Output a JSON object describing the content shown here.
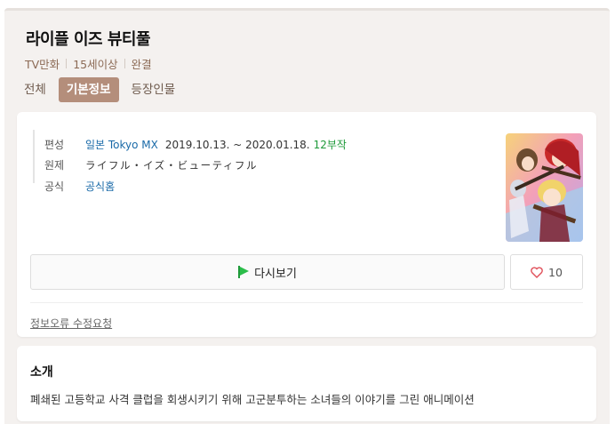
{
  "title": "라이플 이즈 뷰티풀",
  "meta": [
    "TV만화",
    "15세이상",
    "완결"
  ],
  "tabs": [
    {
      "label": "전체",
      "active": false
    },
    {
      "label": "기본정보",
      "active": true
    },
    {
      "label": "등장인물",
      "active": false
    }
  ],
  "info": {
    "broadcast_label": "편성",
    "channel": "일본 Tokyo MX",
    "dates": "2019.10.13. ~ 2020.01.18.",
    "episodes": "12부작",
    "original_label": "원제",
    "original_title": "ライフル・イズ・ビューティフル",
    "official_label": "공식",
    "official_link": "공식홈"
  },
  "poster": {
    "icon": "anime-poster-image"
  },
  "replay_button": "다시보기",
  "like": {
    "count": "10"
  },
  "report_link": "정보오류 수정요청",
  "intro": {
    "title": "소개",
    "text": "폐쇄된 고등학교 사격 클럽을 회생시키기 위해 고군분투하는 소녀들의 이야기를 그린 애니메이션"
  },
  "colors": {
    "accent": "#b48e7b",
    "link_blue": "#1a6aa8",
    "green": "#1f9a3a",
    "meta_brown": "#8c6a55"
  }
}
